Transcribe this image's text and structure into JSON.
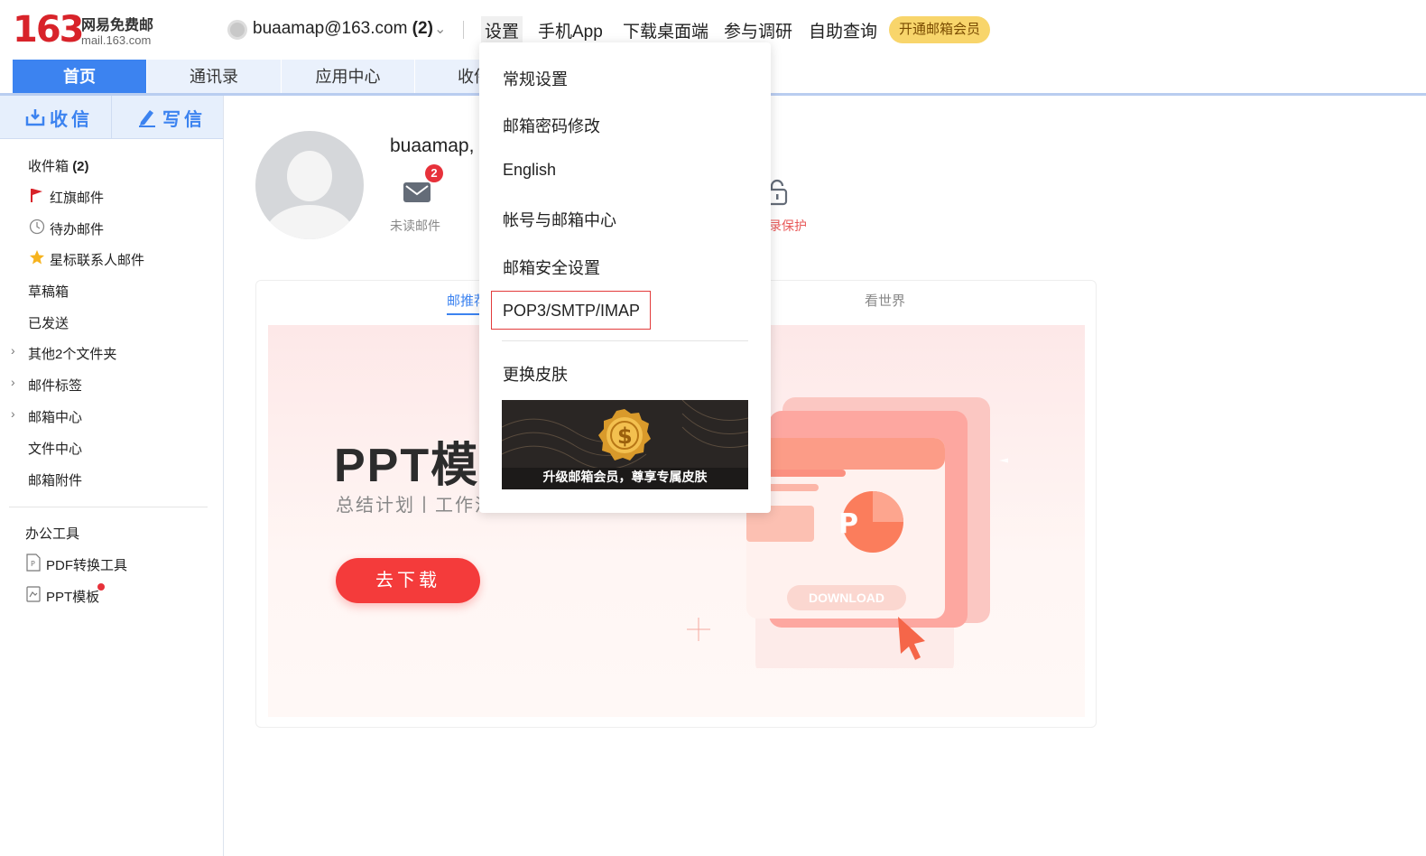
{
  "header": {
    "logo_number": "163",
    "logo_cn": "网易免费邮",
    "logo_url": "mail.163.com",
    "account": "buaamap@163.com",
    "account_count": "(2)",
    "nav": [
      "设置",
      "手机App",
      "下载桌面端",
      "参与调研",
      "自助查询"
    ],
    "vip_button": "开通邮箱会员"
  },
  "tabs": [
    "首页",
    "通讯录",
    "应用中心",
    "收件箱"
  ],
  "sidebar": {
    "receive": "收信",
    "write": "写信",
    "inbox": "收件箱",
    "inbox_count": "(2)",
    "items": [
      "红旗邮件",
      "待办邮件",
      "星标联系人邮件",
      "草稿箱",
      "已发送",
      "其他2个文件夹",
      "邮件标签",
      "邮箱中心",
      "文件中心",
      "邮箱附件"
    ],
    "tools_title": "办公工具",
    "tools": [
      "PDF转换工具",
      "PPT模板"
    ]
  },
  "main": {
    "user_name": "buaamap,",
    "unread_count": "2",
    "unread_label": "未读邮件",
    "protect_label": "录保护",
    "card_tabs": [
      "邮推荐",
      "看世界"
    ],
    "banner_title": "PPT模",
    "banner_sub": "总结计划丨工作汇",
    "banner_download": "DOWNLOAD",
    "banner_button": "去下载"
  },
  "dropdown": {
    "items": [
      "常规设置",
      "邮箱密码修改",
      "English",
      "帐号与邮箱中心",
      "邮箱安全设置",
      "POP3/SMTP/IMAP",
      "更换皮肤"
    ],
    "skin_promo": "升级邮箱会员，尊享专属皮肤"
  },
  "colors": {
    "brand_red": "#d8232a",
    "primary_blue": "#3c83f0",
    "tab_bg": "#eaf1fc",
    "vip_yellow": "#f8d56b",
    "highlight_red": "#e23b3b"
  }
}
